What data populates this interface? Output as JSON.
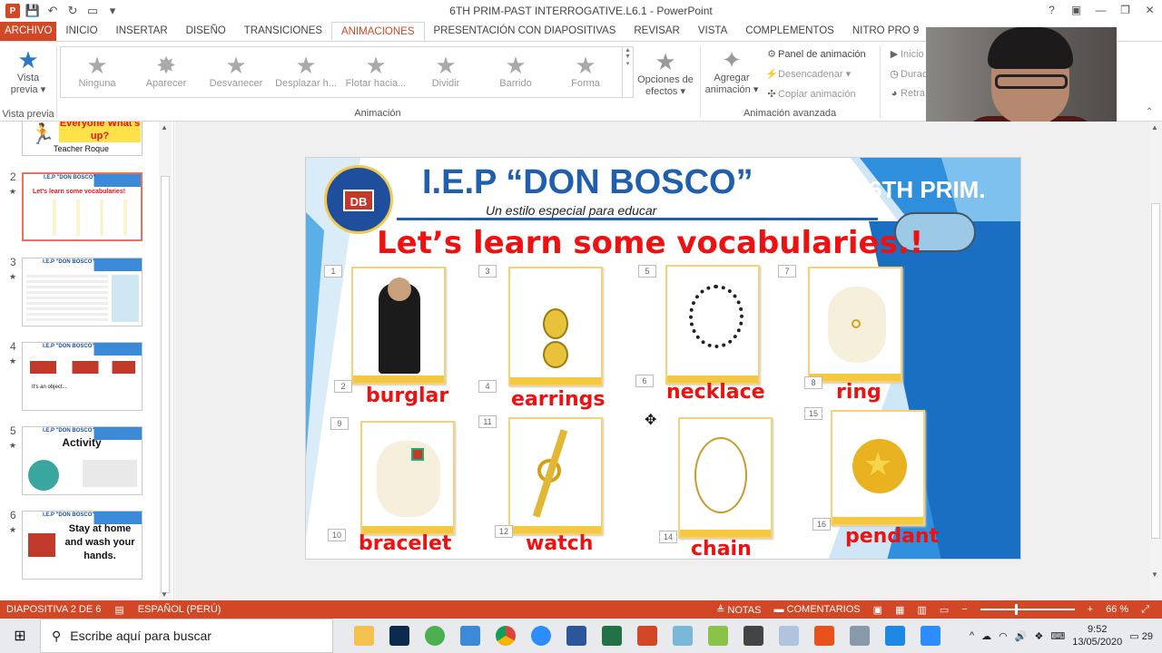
{
  "titlebar": {
    "title": "6TH PRIM-PAST INTERROGATIVE.L6.1 - PowerPoint",
    "help": "?"
  },
  "tabs": [
    "ARCHIVO",
    "INICIO",
    "INSERTAR",
    "DISEÑO",
    "TRANSICIONES",
    "ANIMACIONES",
    "PRESENTACIÓN CON DIAPOSITIVAS",
    "REVISAR",
    "VISTA",
    "COMPLEMENTOS",
    "NITRO PRO 9"
  ],
  "ribbon": {
    "preview": {
      "label1": "Vista",
      "label2": "previa ▾",
      "group": "Vista previa"
    },
    "gallery": [
      "Ninguna",
      "Aparecer",
      "Desvanecer",
      "Desplazar h...",
      "Flotar hacia...",
      "Dividir",
      "Barrido",
      "Forma"
    ],
    "effect_options": {
      "label1": "Opciones de",
      "label2": "efectos ▾"
    },
    "animation_group": "Animación",
    "add_animation": {
      "label1": "Agregar",
      "label2": "animación ▾"
    },
    "advanced": [
      "Panel de animación",
      "Desencadenar ▾",
      "Copiar animación"
    ],
    "advanced_group": "Animación avanzada",
    "timing": [
      "Inicio",
      "Durac",
      "Retra"
    ]
  },
  "thumbnails": [
    {
      "num": "",
      "title": "Everyone What's up?",
      "sub": "Teacher Roque"
    },
    {
      "num": "2",
      "title": "Let's learn some vocabularies!"
    },
    {
      "num": "3",
      "title": ""
    },
    {
      "num": "4",
      "title": "It's an object..."
    },
    {
      "num": "5",
      "title": "Activity"
    },
    {
      "num": "6",
      "title": "Stay at home and wash your hands."
    }
  ],
  "thumb_band": "I.E.P \"DON BOSCO\"",
  "slide": {
    "school": "I.E.P “DON BOSCO”",
    "slogan": "Un estilo especial para educar",
    "grade": "6TH PRIM.",
    "headline": "Let’s learn some vocabularies.!",
    "logo_text": "DB",
    "words": [
      "burglar",
      "earrings",
      "necklace",
      "ring",
      "bracelet",
      "watch",
      "chain",
      "pendant"
    ],
    "numbers": [
      "1",
      "2",
      "3",
      "4",
      "5",
      "6",
      "7",
      "8",
      "9",
      "10",
      "11",
      "12",
      "14",
      "15",
      "16"
    ]
  },
  "status": {
    "slide": "DIAPOSITIVA 2 DE 6",
    "language": "ESPAÑOL (PERÚ)",
    "notes": "NOTAS",
    "comments": "COMENTARIOS",
    "zoom": "66 %"
  },
  "taskbar": {
    "search_placeholder": "Escribe aquí para buscar",
    "time": "9:52",
    "date": "13/05/2020",
    "notifications": "29"
  },
  "colors": {
    "accent": "#d24726",
    "slide_blue": "#1f5fae",
    "vocab_red": "#e11111"
  }
}
